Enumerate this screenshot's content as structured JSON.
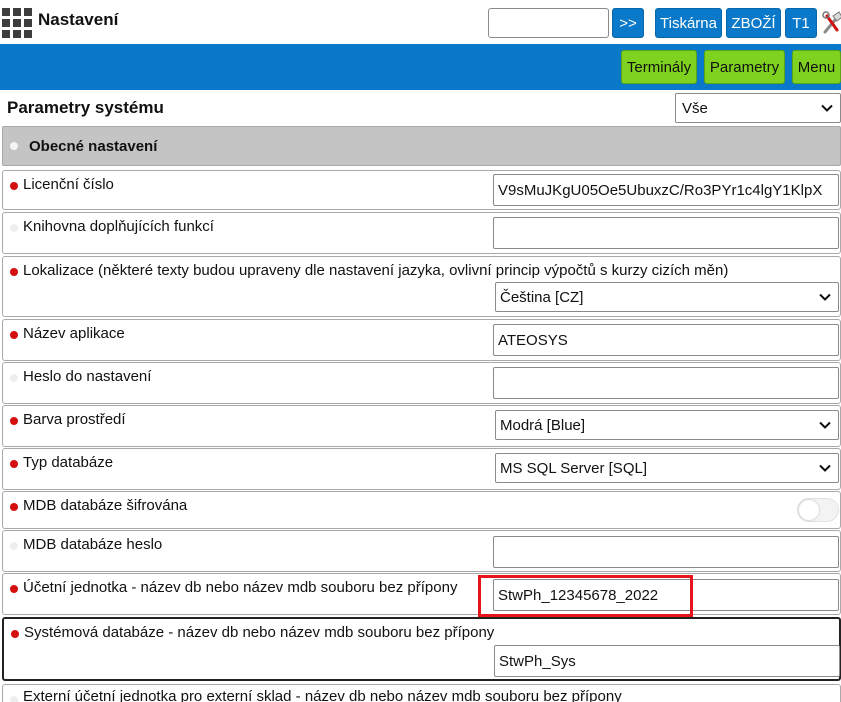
{
  "header": {
    "title": "Nastavení",
    "search_value": "",
    "go_label": ">>",
    "printer_label": "Tiskárna",
    "goods_label": "ZBOŽÍ",
    "terminal_label": "T1"
  },
  "toolbar": {
    "terminals_label": "Terminály",
    "parameters_label": "Parametry",
    "menu_label": "Menu"
  },
  "page": {
    "title": "Parametry systému",
    "filter_value": "Vše"
  },
  "section": {
    "title": "Obecné nastavení"
  },
  "settings": [
    {
      "label": "Licenční číslo",
      "value": "V9sMuJKgU05Oe5UbuxzC/Ro3PYr1c4lgY1KlpX",
      "marker": "red"
    },
    {
      "label": "Knihovna doplňujících funkcí",
      "value": "",
      "marker": "pale"
    },
    {
      "label": "Lokalizace (některé texty budou upraveny dle nastavení jazyka, ovlivní princip výpočtů s kurzy cizích měn)",
      "value": "Čeština [CZ]",
      "marker": "red"
    },
    {
      "label": "Název aplikace",
      "value": "ATEOSYS",
      "marker": "red"
    },
    {
      "label": "Heslo do nastavení",
      "value": "",
      "marker": "pale"
    },
    {
      "label": "Barva prostředí",
      "value": "Modrá [Blue]",
      "marker": "red"
    },
    {
      "label": "Typ databáze",
      "value": "MS SQL Server [SQL]",
      "marker": "red"
    },
    {
      "label": "MDB databáze šifrována",
      "value_toggle": false,
      "marker": "red"
    },
    {
      "label": "MDB databáze heslo",
      "value": "",
      "marker": "pale"
    },
    {
      "label": "Účetní jednotka - název db nebo název mdb souboru bez přípony",
      "value": "StwPh_12345678_2022",
      "marker": "red"
    },
    {
      "label": "Systémová databáze - název db nebo název mdb souboru bez přípony",
      "value": "StwPh_Sys",
      "marker": "red"
    },
    {
      "label": "Externí účetní jednotka pro externí sklad - název db nebo název mdb souboru bez přípony",
      "marker": "pale"
    }
  ],
  "colors": {
    "accent_blue": "#0a79c9",
    "button_green": "#7fd320",
    "required_marker": "#d30f0f",
    "highlight": "#e8141c"
  }
}
